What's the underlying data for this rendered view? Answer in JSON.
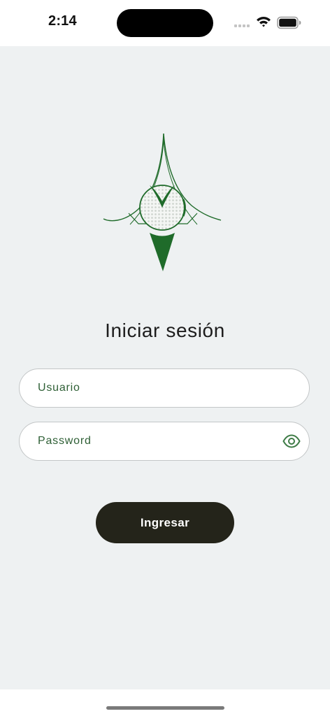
{
  "status_bar": {
    "time": "2:14"
  },
  "login": {
    "title": "Iniciar sesión",
    "username_placeholder": "Usuario",
    "password_placeholder": "Password",
    "submit_label": "Ingresar"
  },
  "icons": {
    "logo": "club-logo-icon",
    "password_toggle": "eye-icon",
    "wifi": "wifi-icon",
    "battery": "battery-icon"
  },
  "colors": {
    "brand_green": "#1f6b2a",
    "label_green": "#2e5f35",
    "button_dark": "#24241a",
    "background": "#eef1f2"
  }
}
